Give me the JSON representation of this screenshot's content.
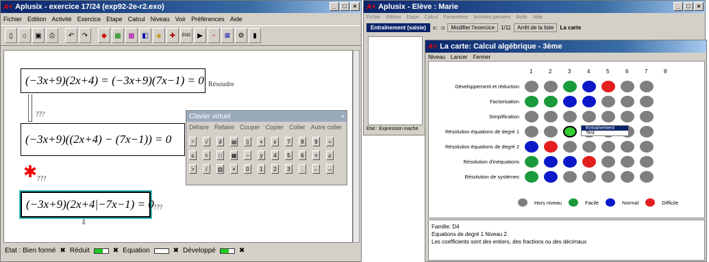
{
  "left": {
    "title": "Aplusix - exercice 17/24  (exp92-2e-r2.exo)",
    "menu": [
      "Fichier",
      "Edition",
      "Activité",
      "Exercice",
      "Etape",
      "Calcul",
      "Niveau",
      "Voir",
      "Préférences",
      "Aide"
    ],
    "eq1": "(−3x+9)(2x+4) = (−3x+9)(7x−1) = 0",
    "eq1_note": "Résoudre",
    "eq2": "(−3x+9)((2x+4) − (7x−1)) = 0",
    "eq3": "(−3x+9)(2x+4|−7x−1) = 0",
    "q1": "???",
    "q2": "???",
    "q3": "???",
    "q4": "???",
    "status": {
      "state": "Etat : Bien formé",
      "reduit": "Réduit",
      "equation": "Equation",
      "developpe": "Développé"
    },
    "keyboard": {
      "title": "Clavier virtuel",
      "actions": [
        "Défaire",
        "Refaire",
        "Couper",
        "Copier",
        "Coller",
        "Autre coller"
      ]
    }
  },
  "right": {
    "title": "Aplusix - Elève : Marie",
    "menu": [
      "Fichier",
      "Edition",
      "Etape",
      "Calcul",
      "Paramètres",
      "Activités passées",
      "Boîte",
      "Aide"
    ],
    "mode": "Entraînement (saisie)",
    "modify": "Modifier l'exercice",
    "page": "1/11",
    "stop": "Arrêt de la liste",
    "map_btn": "La carte",
    "status": "Etat : Expression inache",
    "map": {
      "title": "La carte: Calcul algébrique - 3ème",
      "menu": [
        "Niveau",
        "Lancer",
        "Fermer"
      ],
      "cols": [
        "1",
        "2",
        "3",
        "4",
        "5",
        "6",
        "7",
        "8"
      ],
      "rows": [
        {
          "label": "Développement et réduction",
          "dots": [
            "grey",
            "grey",
            "green",
            "blue",
            "red",
            "grey",
            "grey"
          ]
        },
        {
          "label": "Factorisation",
          "dots": [
            "green",
            "green",
            "blue",
            "blue",
            "grey",
            "grey",
            "grey"
          ]
        },
        {
          "label": "Simplification",
          "dots": [
            "grey",
            "grey",
            "grey",
            "grey",
            "grey",
            "grey",
            "grey"
          ]
        },
        {
          "label": "Résolution équations de degré 1",
          "dots": [
            "grey",
            "grey",
            "green",
            "grey",
            "grey",
            "grey",
            "grey"
          ]
        },
        {
          "label": "Résolution équations de degré 2",
          "dots": [
            "blue",
            "red",
            "grey",
            "grey",
            "grey",
            "grey",
            "grey"
          ]
        },
        {
          "label": "Résolution d'inéquations",
          "dots": [
            "green",
            "blue",
            "blue",
            "red",
            "grey",
            "grey",
            "grey"
          ]
        },
        {
          "label": "Résolution de systèmes",
          "dots": [
            "green",
            "blue",
            "grey",
            "grey",
            "grey",
            "grey",
            "grey"
          ]
        }
      ],
      "context_menu": [
        "Entraînement",
        "Test"
      ],
      "legend": [
        {
          "label": "Hors niveau",
          "color": "grey"
        },
        {
          "label": "Facile",
          "color": "green"
        },
        {
          "label": "Normal",
          "color": "blue"
        },
        {
          "label": "Difficile",
          "color": "red"
        }
      ],
      "info": [
        "Famille: D4",
        "Equations de degré 1 Niveau 2.",
        "Les coefficients sont des entiers, des fractions ou des décimaux"
      ]
    }
  }
}
